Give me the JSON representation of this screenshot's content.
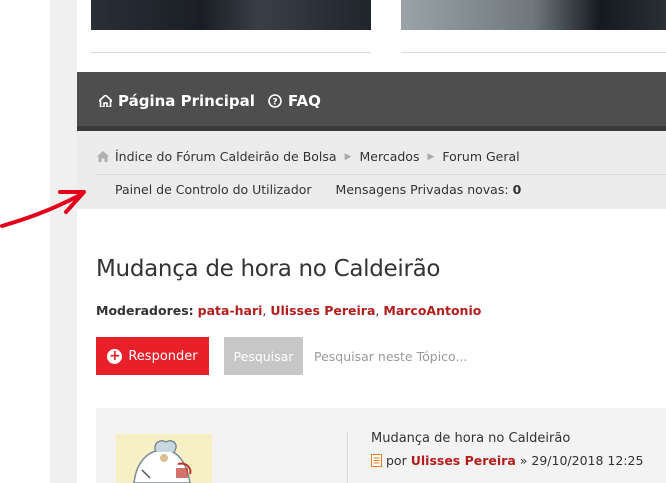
{
  "nav": {
    "home_label": "Página Principal",
    "faq_label": "FAQ"
  },
  "breadcrumbs": {
    "items": [
      "Índice do Fórum Caldeirão de Bolsa",
      "Mercados",
      "Forum Geral"
    ]
  },
  "user_bar": {
    "control_panel": "Painel de Controlo do Utilizador",
    "private_messages_label": "Mensagens Privadas novas:",
    "private_messages_count": "0"
  },
  "topic": {
    "title": "Mudança de hora no Caldeirão",
    "moderators_label": "Moderadores:",
    "moderators": [
      "pata-hari",
      "Ulisses Pereira",
      "MarcoAntonio"
    ],
    "moderator_separator": ", "
  },
  "actions": {
    "reply_label": "Responder",
    "search_label": "Pesquisar",
    "search_placeholder": "Pesquisar neste Tópico..."
  },
  "post": {
    "title": "Mudança de hora no Caldeirão",
    "by": "por",
    "author": "Ulisses Pereira",
    "date": "» 29/10/2018 12:25"
  },
  "colors": {
    "navbar": "#4e4e4e",
    "accent_red": "#e8202a",
    "link_red": "#b21d1d",
    "annotation_arrow": "#e3001b"
  }
}
